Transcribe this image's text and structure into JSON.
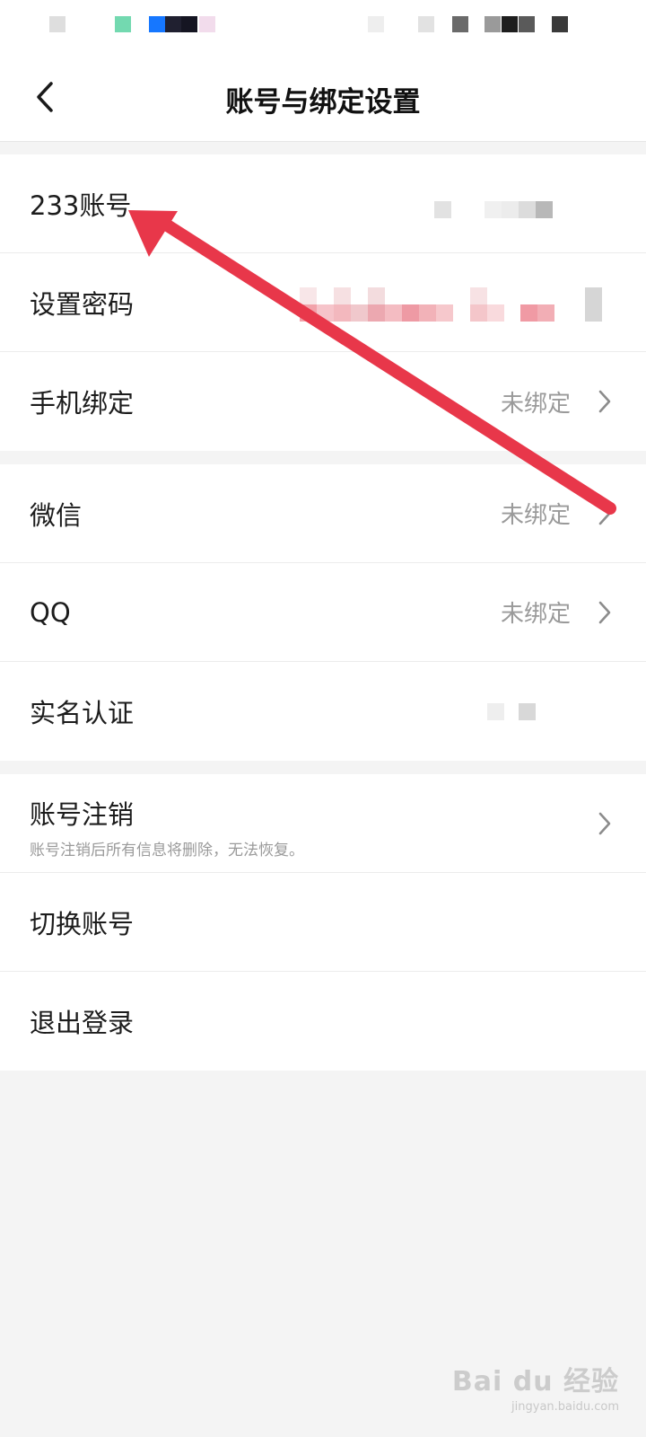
{
  "header": {
    "title": "账号与绑定设置"
  },
  "groups": {
    "account": {
      "account_label": "233账号",
      "password_label": "设置密码",
      "phone_label": "手机绑定",
      "phone_value": "未绑定"
    },
    "social": {
      "wechat_label": "微信",
      "wechat_value": "未绑定",
      "qq_label": "QQ",
      "qq_value": "未绑定",
      "realname_label": "实名认证"
    },
    "session": {
      "cancel_label": "账号注销",
      "cancel_sub": "账号注销后所有信息将删除，无法恢复。",
      "switch_label": "切换账号",
      "logout_label": "退出登录"
    }
  },
  "watermark": {
    "logo": "Bai du 经验",
    "url": "jingyan.baidu.com"
  },
  "icons": {
    "back": "chevron-left-icon",
    "row_arrow": "chevron-right-icon"
  },
  "colors": {
    "annotation_arrow": "#e8374a",
    "background": "#f4f4f4",
    "value_text": "#9a9a9a"
  }
}
